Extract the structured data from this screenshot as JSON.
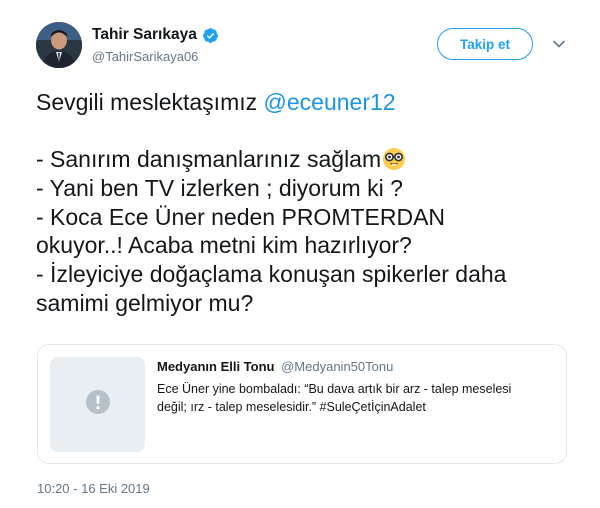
{
  "author": {
    "display_name": "Tahir Sarıkaya",
    "handle": "@TahirSarikaya06",
    "verified_icon": "verified-badge-icon"
  },
  "actions": {
    "follow_label": "Takip et",
    "menu_icon": "chevron-down-icon"
  },
  "tweet": {
    "line1_text": "Sevgili meslektaşımız ",
    "line1_mention": "@eceuner12",
    "line2_text": "- Sanırım danışmanlarınız sağlam",
    "line2_emoji": "nerd-face-icon",
    "line3": "- Yani ben TV izlerken ; diyorum ki ?",
    "line4": "- Koca Ece Üner neden PROMTERDAN",
    "line5": "okuyor..! Acaba metni kim hazırlıyor?",
    "line6": "- İzleyiciye doğaçlama konuşan spikerler daha",
    "line7": "samimi gelmiyor mu?"
  },
  "quoted": {
    "name": "Medyanın Elli Tonu",
    "handle": "@Medyanin50Tonu",
    "text_line1": "Ece Üner yine bombaladı: “Bu dava artık bir arz - talep meselesi",
    "text_line2": "değil; ırz - talep meselesidir.” #SuleÇetİçinAdalet",
    "media_icon": "unavailable-media-icon"
  },
  "timestamp": "10:20 - 16 Eki 2019",
  "colors": {
    "accent": "#1da1f2",
    "mention": "#1b95e0",
    "secondary_text": "#657786",
    "border": "#e1e8ed"
  }
}
